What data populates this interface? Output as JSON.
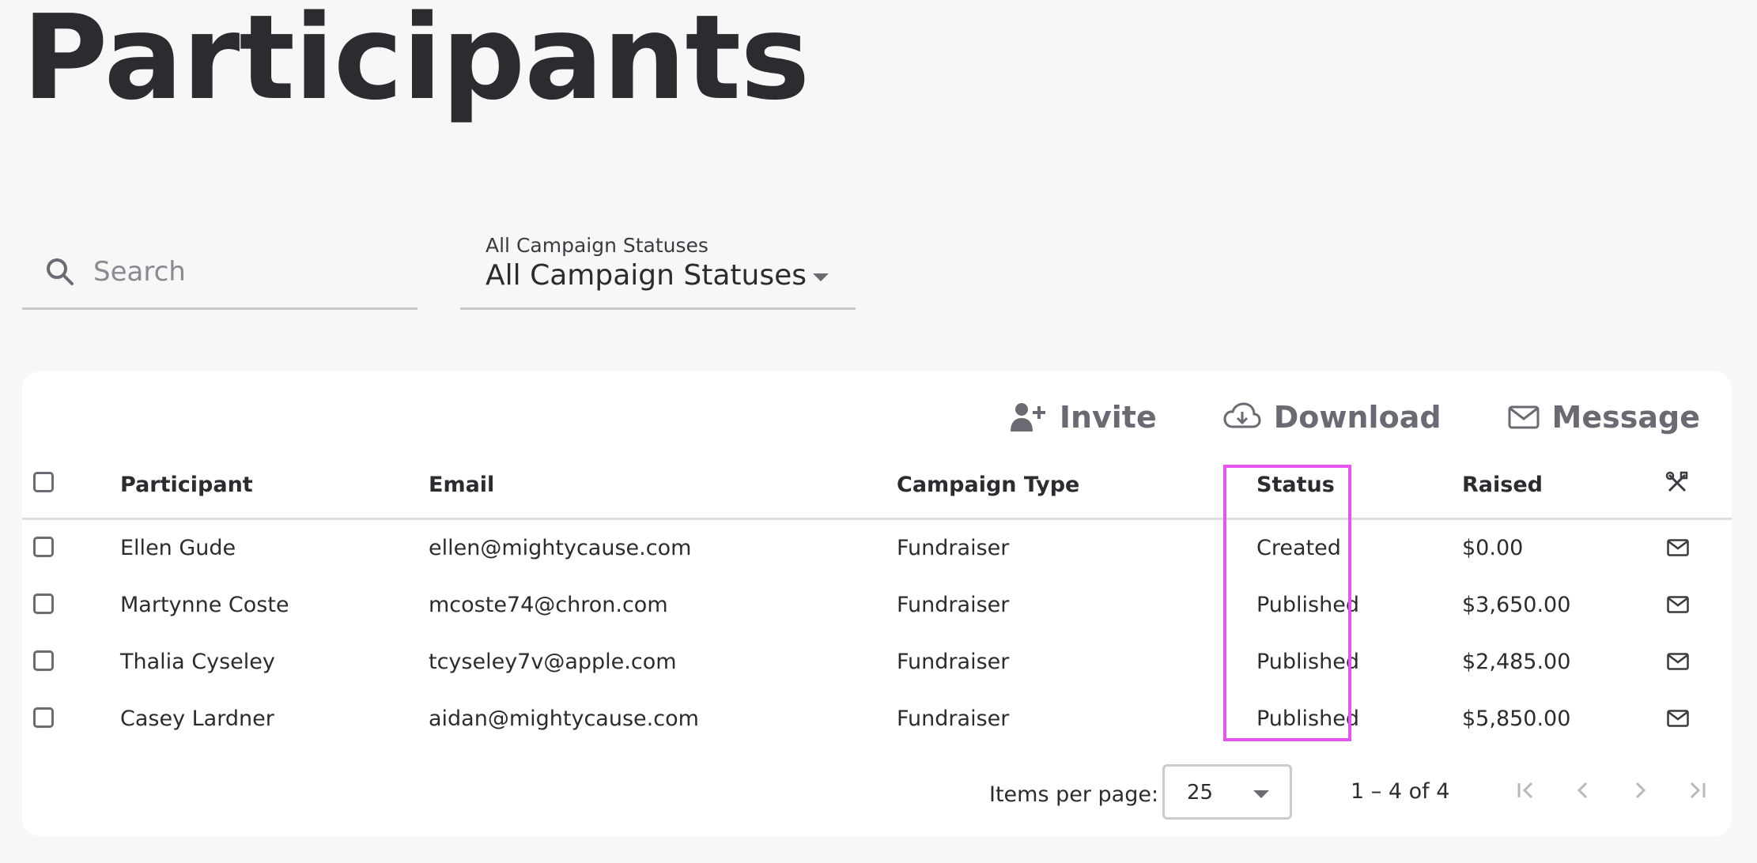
{
  "page": {
    "title": "Participants"
  },
  "filters": {
    "search": {
      "placeholder": "Search",
      "value": ""
    },
    "campaign_status": {
      "label": "All Campaign Statuses",
      "value": "All Campaign Statuses"
    }
  },
  "toolbar": {
    "invite_label": "Invite",
    "download_label": "Download",
    "message_label": "Message"
  },
  "table": {
    "columns": {
      "participant": "Participant",
      "email": "Email",
      "campaign_type": "Campaign Type",
      "status": "Status",
      "raised": "Raised",
      "actions_icon": "tools-icon"
    },
    "rows": [
      {
        "participant": "Ellen Gude",
        "email": "ellen@mightycause.com",
        "campaign_type": "Fundraiser",
        "status": "Created",
        "raised": "$0.00"
      },
      {
        "participant": "Martynne Coste",
        "email": "mcoste74@chron.com",
        "campaign_type": "Fundraiser",
        "status": "Published",
        "raised": "$3,650.00"
      },
      {
        "participant": "Thalia Cyseley",
        "email": "tcyseley7v@apple.com",
        "campaign_type": "Fundraiser",
        "status": "Published",
        "raised": "$2,485.00"
      },
      {
        "participant": "Casey Lardner",
        "email": "aidan@mightycause.com",
        "campaign_type": "Fundraiser",
        "status": "Published",
        "raised": "$5,850.00"
      }
    ]
  },
  "paginator": {
    "items_per_page_label": "Items per page:",
    "items_per_page": "25",
    "range": "1 – 4 of 4"
  },
  "colors": {
    "background": "#f7f7f8",
    "card": "#ffffff",
    "text": "#2b2b30",
    "muted": "#6a6a72",
    "highlight": "#e854f0"
  }
}
